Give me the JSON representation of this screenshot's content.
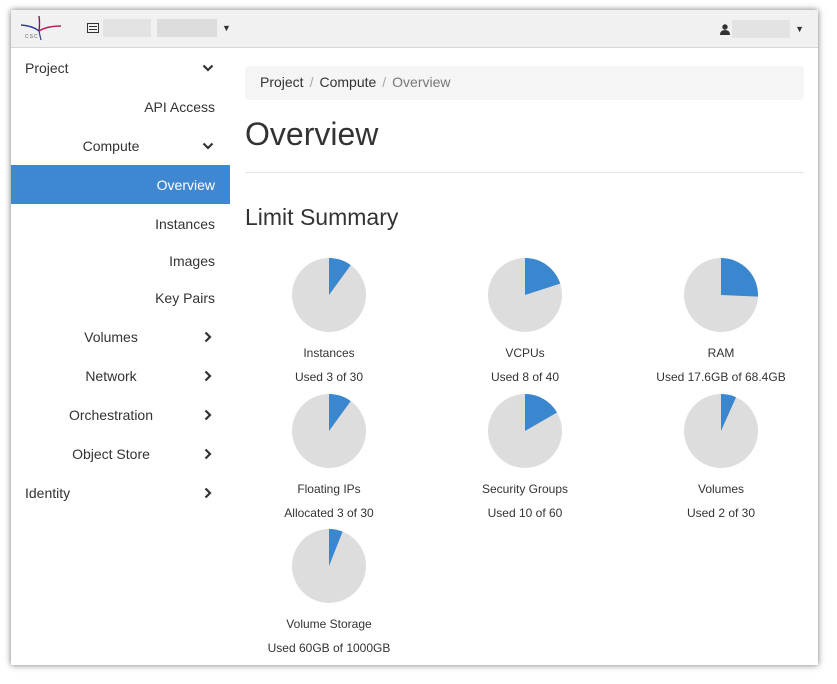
{
  "colors": {
    "accent": "#3f88d1",
    "pie_used": "#3a87cf",
    "pie_free": "#dddddd"
  },
  "header": {
    "logo_icon": "csc-logo",
    "logo_text": "CSC",
    "project_selector_icon": "server-list-icon",
    "user_icon": "user-icon"
  },
  "sidebar": {
    "project": "Project",
    "api_access": "API Access",
    "compute": "Compute",
    "overview": "Overview",
    "instances": "Instances",
    "images": "Images",
    "key_pairs": "Key Pairs",
    "volumes": "Volumes",
    "network": "Network",
    "orchestration": "Orchestration",
    "object_store": "Object Store",
    "identity": "Identity"
  },
  "breadcrumb": {
    "project": "Project",
    "compute": "Compute",
    "current": "Overview"
  },
  "page_title": "Overview",
  "section_title": "Limit Summary",
  "limits": [
    {
      "label": "Instances",
      "usage": "Used 3 of 30",
      "fraction": 0.1
    },
    {
      "label": "VCPUs",
      "usage": "Used 8 of 40",
      "fraction": 0.2
    },
    {
      "label": "RAM",
      "usage": "Used 17.6GB of 68.4GB",
      "fraction": 0.257
    },
    {
      "label": "Floating IPs",
      "usage": "Allocated 3 of 30",
      "fraction": 0.1
    },
    {
      "label": "Security Groups",
      "usage": "Used 10 of 60",
      "fraction": 0.1667
    },
    {
      "label": "Volumes",
      "usage": "Used 2 of 30",
      "fraction": 0.0667
    },
    {
      "label": "Volume Storage",
      "usage": "Used 60GB of 1000GB",
      "fraction": 0.06
    }
  ]
}
